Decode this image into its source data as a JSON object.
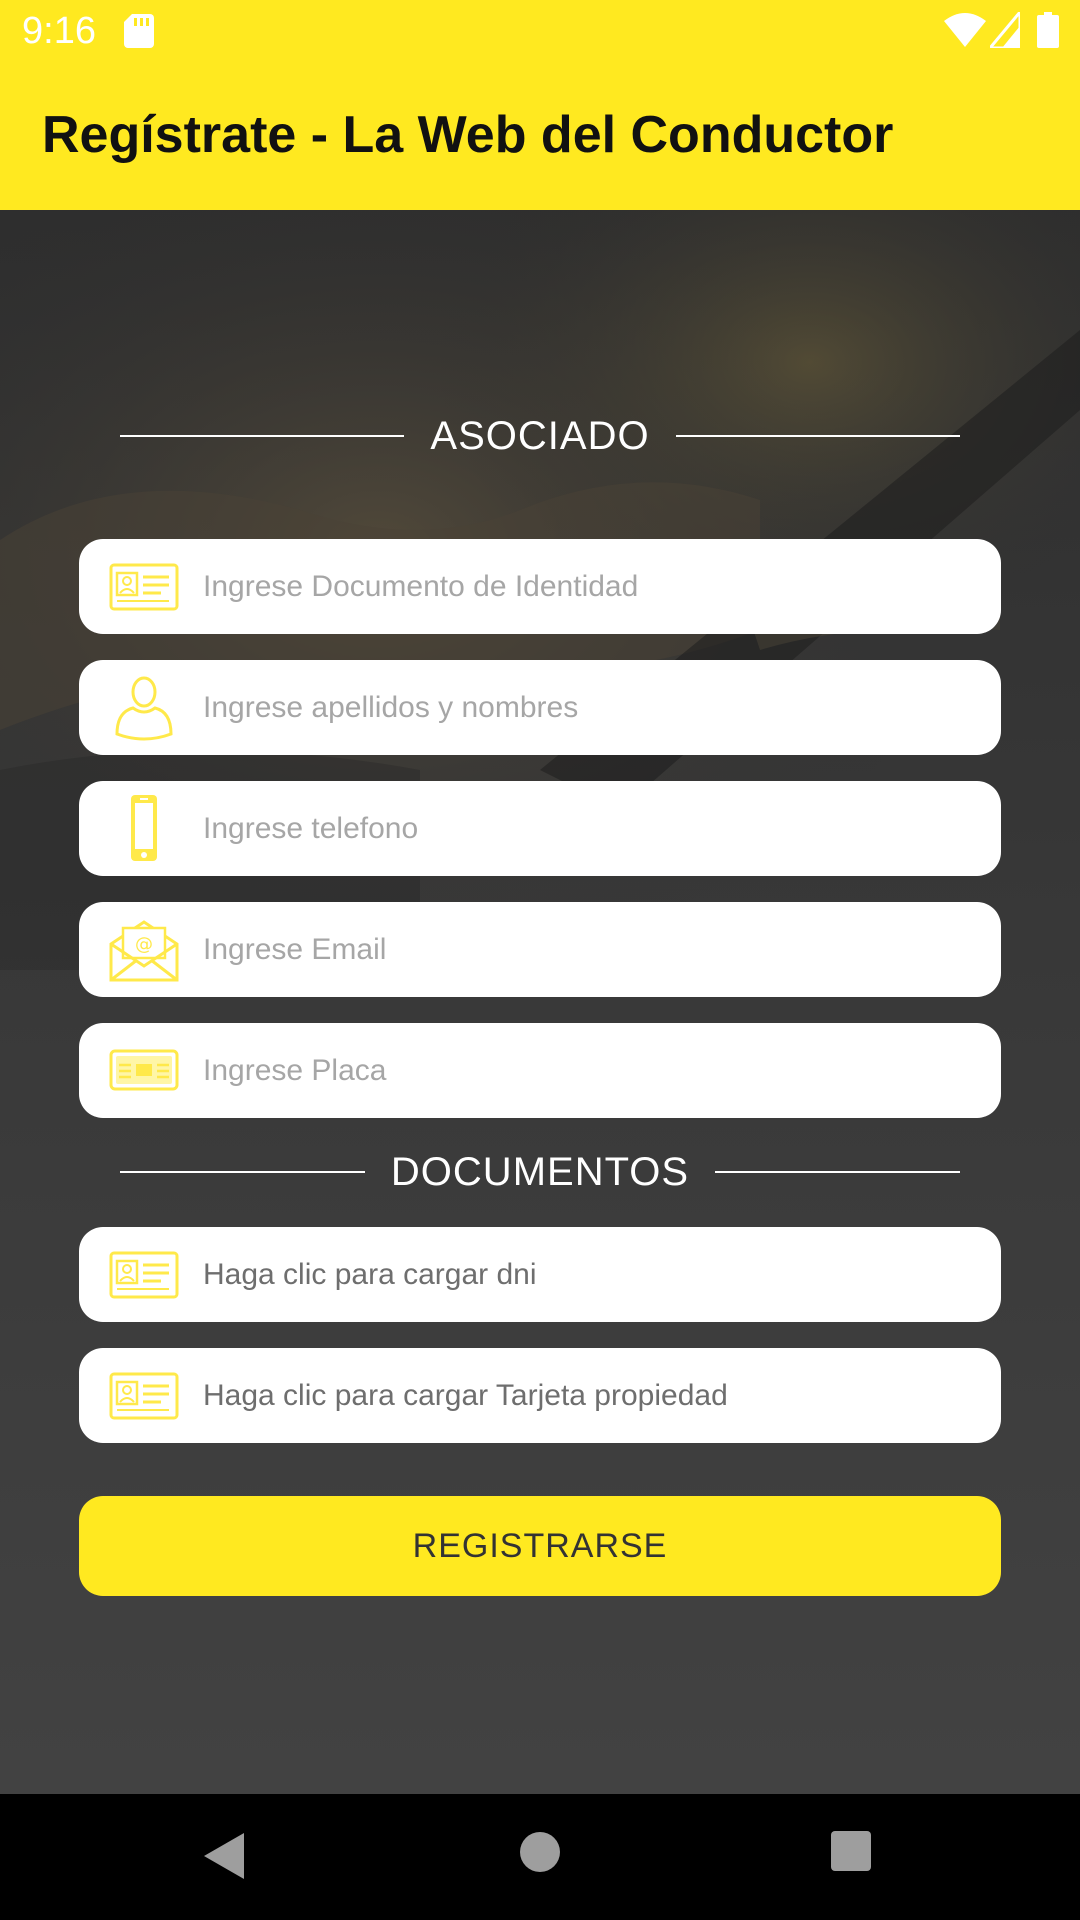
{
  "status_bar": {
    "time": "9:16",
    "icons": [
      "sd-card-icon",
      "wifi-icon",
      "signal-icon",
      "battery-icon"
    ]
  },
  "app_bar": {
    "title": "Regístrate - La Web del Conductor"
  },
  "sections": {
    "asociado": "ASOCIADO",
    "documentos": "DOCUMENTOS"
  },
  "fields": {
    "document": {
      "placeholder": "Ingrese Documento de Identidad",
      "icon": "id-card-icon"
    },
    "name": {
      "placeholder": "Ingrese apellidos y nombres",
      "icon": "user-icon"
    },
    "phone": {
      "placeholder": "Ingrese telefono",
      "icon": "phone-icon"
    },
    "email": {
      "placeholder": "Ingrese Email",
      "icon": "email-icon"
    },
    "plate": {
      "placeholder": "Ingrese Placa",
      "icon": "license-plate-icon"
    }
  },
  "uploads": {
    "dni": {
      "label": "Haga clic para cargar dni",
      "icon": "id-card-icon"
    },
    "tarjeta": {
      "label": "Haga clic para cargar Tarjeta propiedad",
      "icon": "id-card-icon"
    }
  },
  "register_button": "REGISTRARSE",
  "colors": {
    "accent": "#FFE920",
    "icon": "#FFE94A",
    "background": "#363636",
    "placeholder": "#A6A6A6"
  }
}
